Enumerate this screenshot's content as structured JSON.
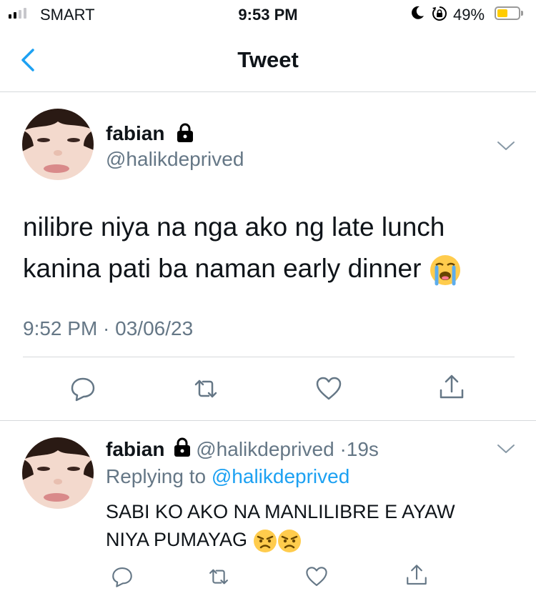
{
  "status_bar": {
    "carrier": "SMART",
    "time": "9:53 PM",
    "battery_percent": "49%",
    "battery_level": 0.49,
    "battery_color": "#ffcc00",
    "icons": [
      "cellular-signal-icon",
      "do-not-disturb-moon-icon",
      "orientation-lock-icon",
      "battery-icon"
    ]
  },
  "nav": {
    "title": "Tweet",
    "back_icon": "chevron-left-icon",
    "accent_color": "#1da1f2"
  },
  "main_tweet": {
    "display_name": "fabian",
    "handle": "@halikdeprived",
    "protected_icon": "lock-icon",
    "text": "nilibre niya na nga ako ng late lunch\nkanina pati ba naman early dinner",
    "emoji": "loudly-crying-face",
    "timestamp": "9:52 PM · 03/06/23",
    "actions": [
      "reply-icon",
      "retweet-icon",
      "like-icon",
      "share-icon"
    ]
  },
  "reply": {
    "display_name": "fabian",
    "handle": "@halikdeprived",
    "time_sep": "·",
    "age": "19s",
    "replying_prefix": "Replying to",
    "replying_to": "@halikdeprived",
    "text": "SABI KO AKO NA MANLILIBRE E AYAW\nNIYA PUMAYAG",
    "emojis": [
      "angry-face",
      "angry-face"
    ],
    "actions": [
      "reply-icon",
      "retweet-icon",
      "like-icon",
      "share-icon"
    ]
  }
}
